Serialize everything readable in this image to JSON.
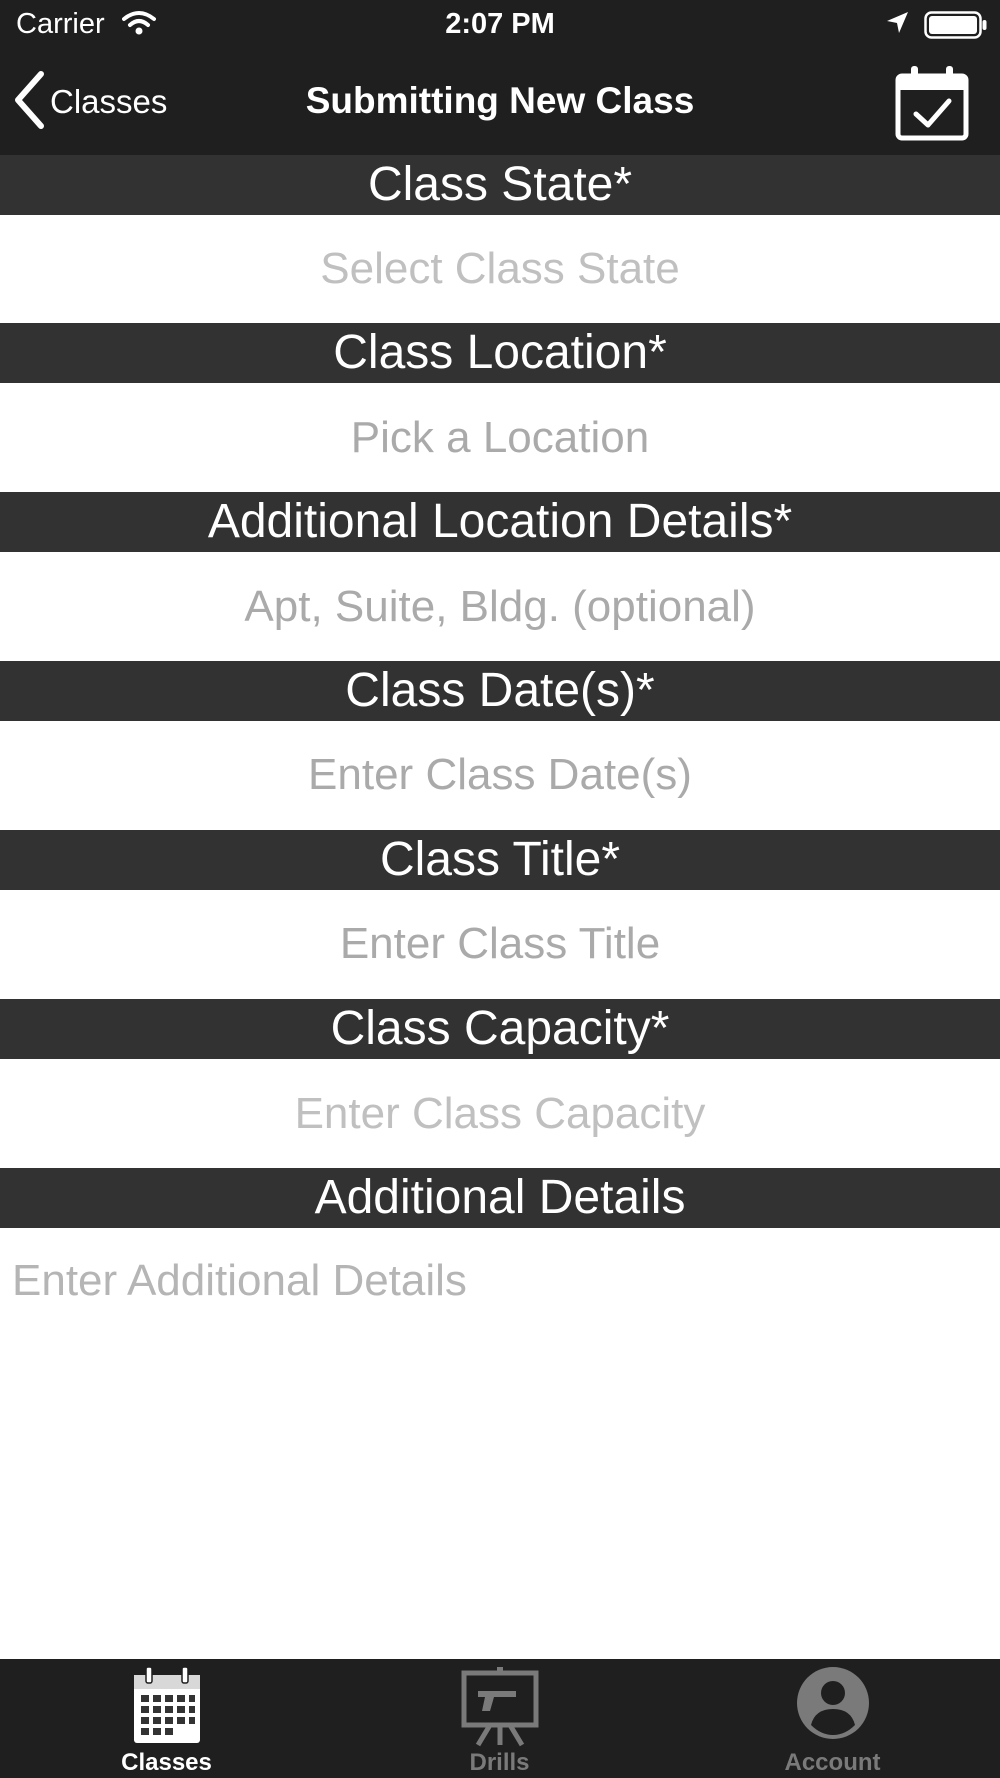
{
  "status_bar": {
    "carrier": "Carrier",
    "time": "2:07 PM"
  },
  "nav": {
    "back_label": "Classes",
    "title": "Submitting New Class",
    "right_icon": "calendar-check-icon"
  },
  "form": {
    "class_state": {
      "label": "Class State*",
      "placeholder": "Select Class State"
    },
    "class_location": {
      "label": "Class Location*",
      "placeholder": "Pick a Location"
    },
    "additional_location": {
      "label": "Additional Location Details*",
      "placeholder": "Apt, Suite, Bldg. (optional)"
    },
    "class_dates": {
      "label": "Class Date(s)*",
      "placeholder": "Enter Class Date(s)"
    },
    "class_title": {
      "label": "Class Title*",
      "placeholder": "Enter Class Title"
    },
    "class_capacity": {
      "label": "Class Capacity*",
      "placeholder": "Enter Class Capacity"
    },
    "additional_details": {
      "label": "Additional Details",
      "placeholder": "Enter Additional Details"
    }
  },
  "tabs": [
    {
      "label": "Classes",
      "icon": "calendar-grid-icon",
      "active": true
    },
    {
      "label": "Drills",
      "icon": "target-easel-icon",
      "active": false
    },
    {
      "label": "Account",
      "icon": "account-icon",
      "active": false
    }
  ],
  "colors": {
    "bar_background": "#1f1f1f",
    "section_header": "#323232",
    "placeholder": "#c0c0c0",
    "tab_inactive": "#7a7a7a"
  }
}
